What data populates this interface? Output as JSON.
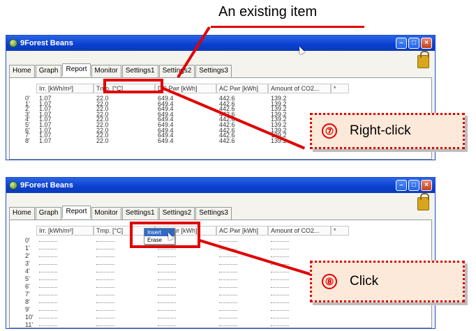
{
  "callout_existing": "An existing item",
  "app_title": "9Forest Beans",
  "tabs": [
    "Home",
    "Graph",
    "Report",
    "Monitor",
    "Settings1",
    "Settings2",
    "Settings3"
  ],
  "active_tab": "Report",
  "columns": [
    "Irr. [kWh/m²]",
    "Tmp. [°C]",
    "DC Pwr [kWh]",
    "AC Pwr [kWh]",
    "Amount of CO2...",
    "*"
  ],
  "row_labels_top": [
    "0'",
    "1'",
    "2'",
    "3'",
    "4'",
    "5'",
    "6'",
    "7'",
    "8'"
  ],
  "row_values_top": [
    "1.07",
    "22.0",
    "649.4",
    "442.6",
    "139.2"
  ],
  "row_labels_bottom": [
    "0'",
    "1'",
    "2'",
    "3'",
    "4'",
    "5'",
    "6'",
    "7'",
    "8'",
    "9'",
    "10'",
    "11'"
  ],
  "step7": {
    "num": "⑦",
    "label": "Right-click"
  },
  "step8": {
    "num": "⑧",
    "label": "Click"
  },
  "context_menu": [
    "Insert",
    "Erase"
  ],
  "colors": {
    "accent_red": "#e00000",
    "title_blue": "#0a3fcf",
    "badge_fill": "#fde9d9"
  }
}
